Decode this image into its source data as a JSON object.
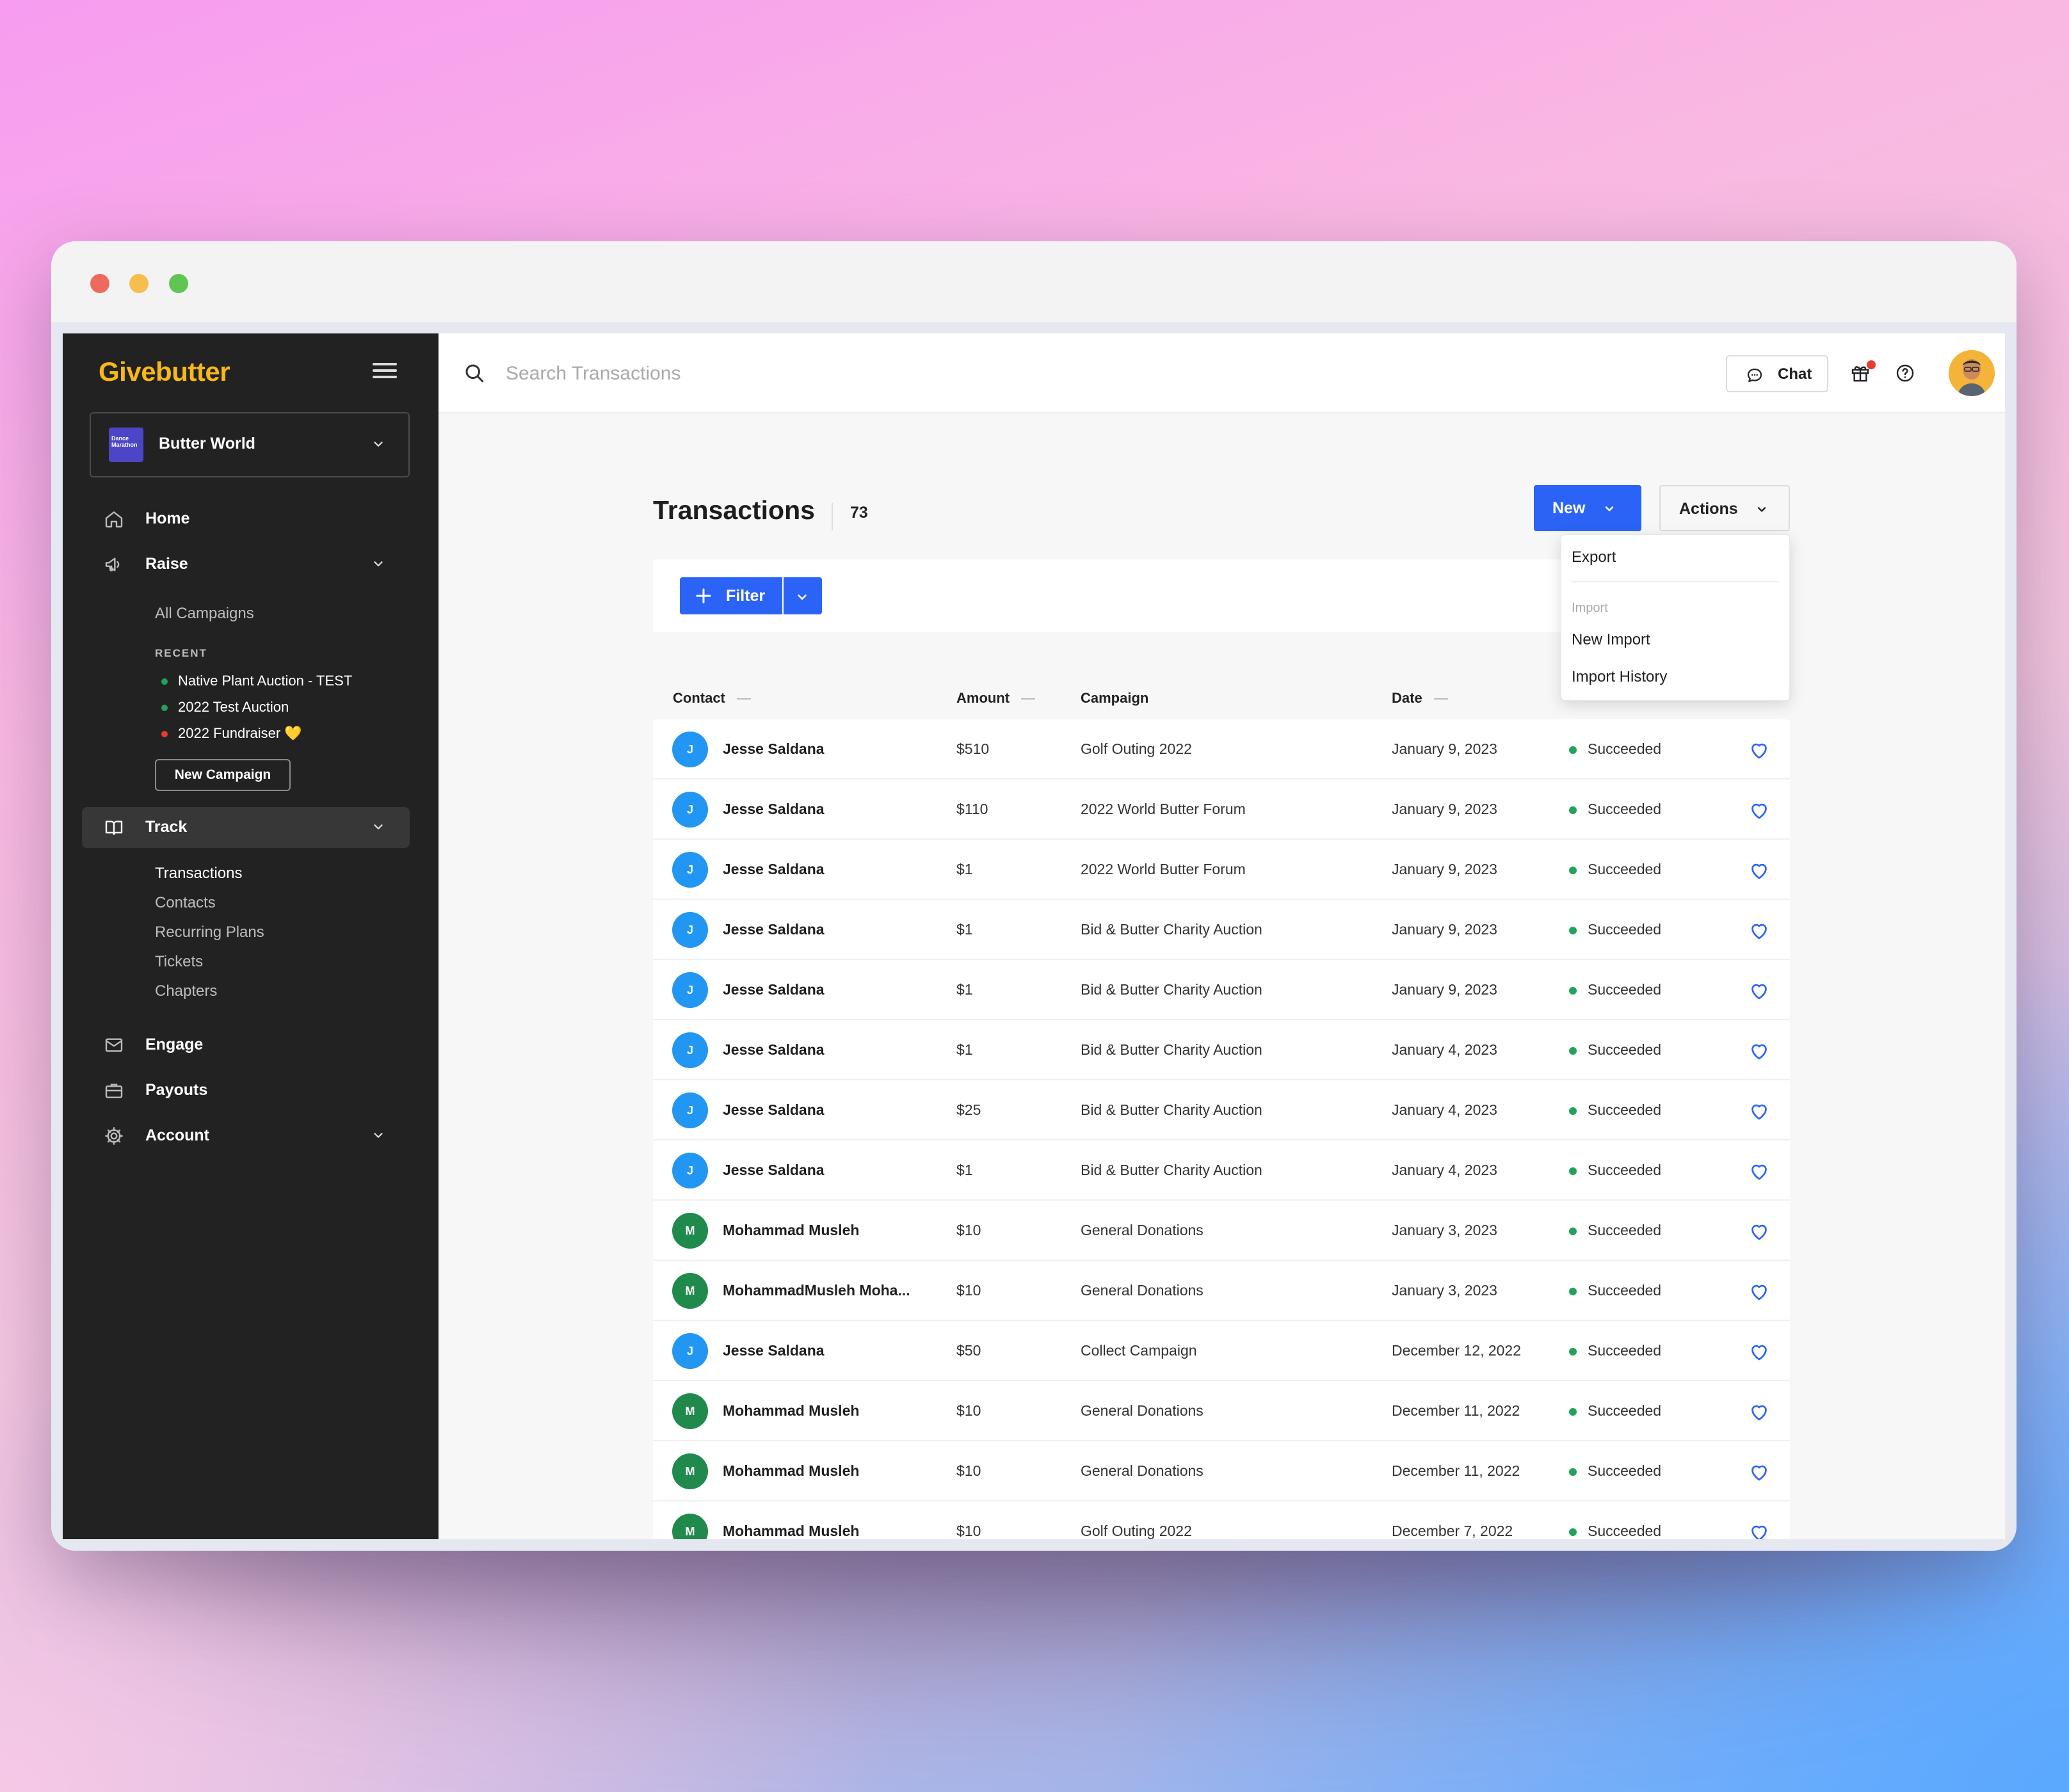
{
  "brand": {
    "name": "Givebutter",
    "color": "#f8b817",
    "accent": "#2a63f5"
  },
  "org": {
    "name": "Butter World",
    "logo_text": "Dance Marathon"
  },
  "nav": {
    "home": "Home",
    "raise": "Raise",
    "all_campaigns": "All Campaigns",
    "recent_heading": "RECENT",
    "recent": [
      {
        "label": "Native Plant Auction - TEST",
        "color": "#22a35a"
      },
      {
        "label": "2022 Test Auction",
        "color": "#22a35a"
      },
      {
        "label": "2022 Fundraiser 💛",
        "color": "#e83b30"
      }
    ],
    "new_campaign": "New Campaign",
    "track": "Track",
    "track_items": [
      "Transactions",
      "Contacts",
      "Recurring Plans",
      "Tickets",
      "Chapters"
    ],
    "engage": "Engage",
    "payouts": "Payouts",
    "account": "Account"
  },
  "topbar": {
    "search_placeholder": "Search Transactions",
    "chat": "Chat"
  },
  "page": {
    "title": "Transactions",
    "count": "73",
    "new_label": "New",
    "actions_label": "Actions",
    "filter_label": "Filter"
  },
  "dropdown": {
    "export": "Export",
    "import_heading": "Import",
    "new_import": "New Import",
    "import_history": "Import History"
  },
  "table": {
    "headers": {
      "contact": "Contact",
      "amount": "Amount",
      "campaign": "Campaign",
      "date": "Date"
    },
    "rows": [
      {
        "initial": "J",
        "avatar_color": "#2196f3",
        "contact": "Jesse Saldana",
        "amount": "$510",
        "campaign": "Golf Outing 2022",
        "date": "January 9, 2023",
        "status": "Succeeded"
      },
      {
        "initial": "J",
        "avatar_color": "#2196f3",
        "contact": "Jesse Saldana",
        "amount": "$110",
        "campaign": "2022 World Butter Forum",
        "date": "January 9, 2023",
        "status": "Succeeded"
      },
      {
        "initial": "J",
        "avatar_color": "#2196f3",
        "contact": "Jesse Saldana",
        "amount": "$1",
        "campaign": "2022 World Butter Forum",
        "date": "January 9, 2023",
        "status": "Succeeded"
      },
      {
        "initial": "J",
        "avatar_color": "#2196f3",
        "contact": "Jesse Saldana",
        "amount": "$1",
        "campaign": "Bid & Butter Charity Auction",
        "date": "January 9, 2023",
        "status": "Succeeded"
      },
      {
        "initial": "J",
        "avatar_color": "#2196f3",
        "contact": "Jesse Saldana",
        "amount": "$1",
        "campaign": "Bid & Butter Charity Auction",
        "date": "January 9, 2023",
        "status": "Succeeded"
      },
      {
        "initial": "J",
        "avatar_color": "#2196f3",
        "contact": "Jesse Saldana",
        "amount": "$1",
        "campaign": "Bid & Butter Charity Auction",
        "date": "January 4, 2023",
        "status": "Succeeded"
      },
      {
        "initial": "J",
        "avatar_color": "#2196f3",
        "contact": "Jesse Saldana",
        "amount": "$25",
        "campaign": "Bid & Butter Charity Auction",
        "date": "January 4, 2023",
        "status": "Succeeded"
      },
      {
        "initial": "J",
        "avatar_color": "#2196f3",
        "contact": "Jesse Saldana",
        "amount": "$1",
        "campaign": "Bid & Butter Charity Auction",
        "date": "January 4, 2023",
        "status": "Succeeded"
      },
      {
        "initial": "M",
        "avatar_color": "#1f8a4c",
        "contact": "Mohammad Musleh",
        "amount": "$10",
        "campaign": "General Donations",
        "date": "January 3, 2023",
        "status": "Succeeded"
      },
      {
        "initial": "M",
        "avatar_color": "#1f8a4c",
        "contact": "MohammadMusleh Moha...",
        "amount": "$10",
        "campaign": "General Donations",
        "date": "January 3, 2023",
        "status": "Succeeded"
      },
      {
        "initial": "J",
        "avatar_color": "#2196f3",
        "contact": "Jesse Saldana",
        "amount": "$50",
        "campaign": "Collect Campaign",
        "date": "December 12, 2022",
        "status": "Succeeded"
      },
      {
        "initial": "M",
        "avatar_color": "#1f8a4c",
        "contact": "Mohammad Musleh",
        "amount": "$10",
        "campaign": "General Donations",
        "date": "December 11, 2022",
        "status": "Succeeded"
      },
      {
        "initial": "M",
        "avatar_color": "#1f8a4c",
        "contact": "Mohammad Musleh",
        "amount": "$10",
        "campaign": "General Donations",
        "date": "December 11, 2022",
        "status": "Succeeded"
      },
      {
        "initial": "M",
        "avatar_color": "#1f8a4c",
        "contact": "Mohammad Musleh",
        "amount": "$10",
        "campaign": "Golf Outing 2022",
        "date": "December 7, 2022",
        "status": "Succeeded"
      }
    ]
  },
  "icons": {
    "search": "search-icon",
    "menu": "hamburger-icon",
    "chat": "chat-bubble-icon",
    "gift": "gift-icon",
    "help": "help-circle-icon",
    "favorite": "heart-icon",
    "home": "home-icon",
    "raise": "megaphone-icon",
    "track": "book-icon",
    "engage": "mail-icon",
    "payouts": "briefcase-icon",
    "account": "gear-icon"
  }
}
